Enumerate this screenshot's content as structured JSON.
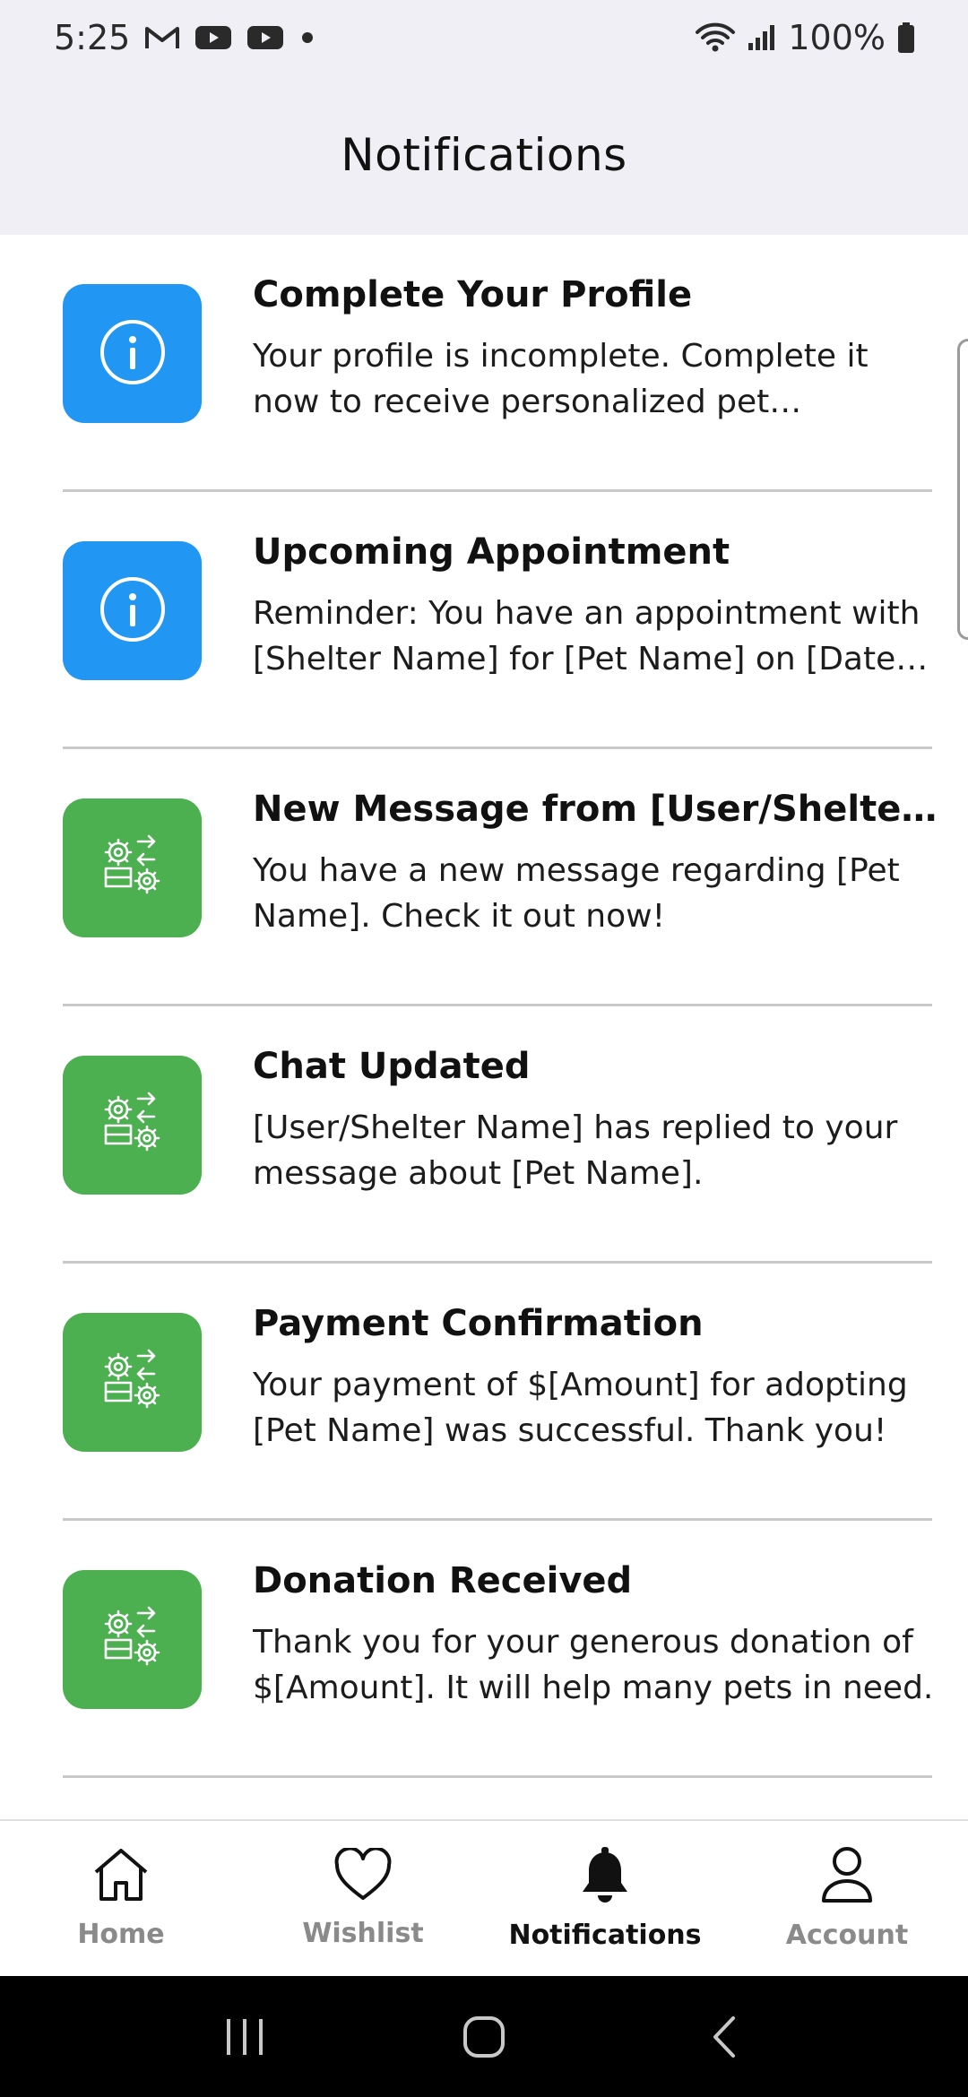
{
  "status_bar": {
    "time": "5:25",
    "battery": "100%",
    "icons": [
      "gmail-icon",
      "youtube-icon",
      "youtube-icon",
      "dot-icon",
      "wifi-icon",
      "signal-icon",
      "battery-icon"
    ]
  },
  "header": {
    "title": "Notifications"
  },
  "notifications": [
    {
      "title": "Complete Your Profile",
      "body": "Your profile is incomplete. Complete it now to receive personalized pet recommendations.",
      "icon": "info-icon",
      "color": "#2196f3"
    },
    {
      "title": "Upcoming Appointment",
      "body": "Reminder: You have an appointment with [Shelter Name] for [Pet Name] on [Date] at [Time].",
      "icon": "info-icon",
      "color": "#2196f3"
    },
    {
      "title": "New Message from [User/Shelter Name]",
      "body": "You have a new message regarding [Pet Name]. Check it out now!",
      "icon": "gears-sync-icon",
      "color": "#4caf50"
    },
    {
      "title": "Chat Updated",
      "body": "[User/Shelter Name] has replied to your message about [Pet Name].",
      "icon": "gears-sync-icon",
      "color": "#4caf50"
    },
    {
      "title": "Payment Confirmation",
      "body": "Your payment of $[Amount] for adopting [Pet Name] was successful. Thank you!",
      "icon": "gears-sync-icon",
      "color": "#4caf50"
    },
    {
      "title": "Donation Received",
      "body": "Thank you for your generous donation of $[Amount]. It will help many pets in need.",
      "icon": "gears-sync-icon",
      "color": "#4caf50"
    }
  ],
  "bottom_nav": {
    "items": [
      {
        "label": "Home",
        "icon": "home-icon",
        "active": false
      },
      {
        "label": "Wishlist",
        "icon": "heart-icon",
        "active": false
      },
      {
        "label": "Notifications",
        "icon": "bell-icon",
        "active": true
      },
      {
        "label": "Account",
        "icon": "person-icon",
        "active": false
      }
    ]
  },
  "system_nav": {
    "buttons": [
      "recents-icon",
      "home-circle-icon",
      "back-icon"
    ]
  },
  "colors": {
    "header_bg": "#f0eff5",
    "info": "#2196f3",
    "message": "#4caf50",
    "active_nav": "#111111",
    "inactive_nav": "#8a8a8a"
  }
}
